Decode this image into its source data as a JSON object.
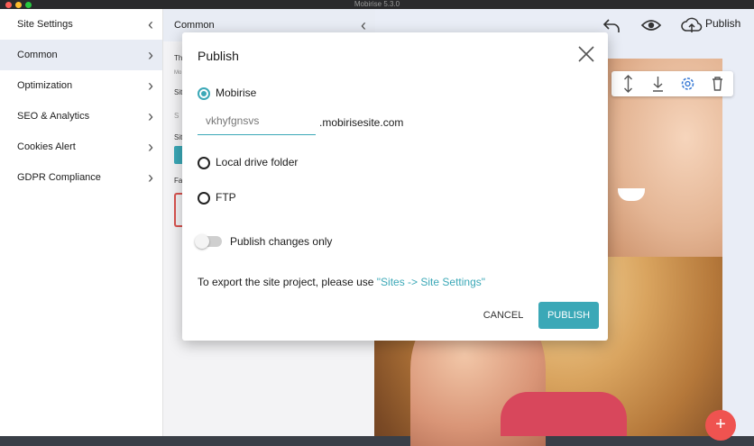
{
  "window": {
    "title": "Mobirise 5.3.0"
  },
  "sidebar": {
    "items": [
      {
        "label": "Site Settings",
        "chevron": "‹"
      },
      {
        "label": "Common",
        "chevron": "›"
      },
      {
        "label": "Optimization",
        "chevron": "›"
      },
      {
        "label": "SEO & Analytics",
        "chevron": "›"
      },
      {
        "label": "Cookies Alert",
        "chevron": "›"
      },
      {
        "label": "GDPR Compliance",
        "chevron": "›"
      }
    ]
  },
  "panel2": {
    "title": "Common",
    "chevron": "‹",
    "stubs": [
      "Th",
      "Mo",
      "Sit",
      "S",
      "Sit",
      "Fa"
    ]
  },
  "topbar": {
    "publish_label": "Publish",
    "icons": [
      "undo-icon",
      "preview-eye-icon",
      "cloud-upload-icon"
    ]
  },
  "block_tools": {
    "icons": [
      "move-arrows-icon",
      "download-icon",
      "gear-icon",
      "trash-icon"
    ]
  },
  "fab": {
    "label": "+"
  },
  "colors": {
    "accent": "#3ba8b7",
    "danger": "#ef5350",
    "sidebar_active": "#e8ecf4"
  },
  "modal": {
    "title": "Publish",
    "close_icon": "close-icon",
    "options": [
      {
        "label": "Mobirise",
        "checked": true
      },
      {
        "label": "Local drive folder",
        "checked": false
      },
      {
        "label": "FTP",
        "checked": false
      }
    ],
    "subdomain": {
      "value": "vkhyfgnsvs",
      "suffix": ".mobirisesite.com"
    },
    "toggle": {
      "label": "Publish changes only",
      "on": false
    },
    "export_text": "To export the site project, please use ",
    "export_link": "\"Sites -> Site Settings\"",
    "cancel_label": "CANCEL",
    "publish_label": "PUBLISH"
  }
}
